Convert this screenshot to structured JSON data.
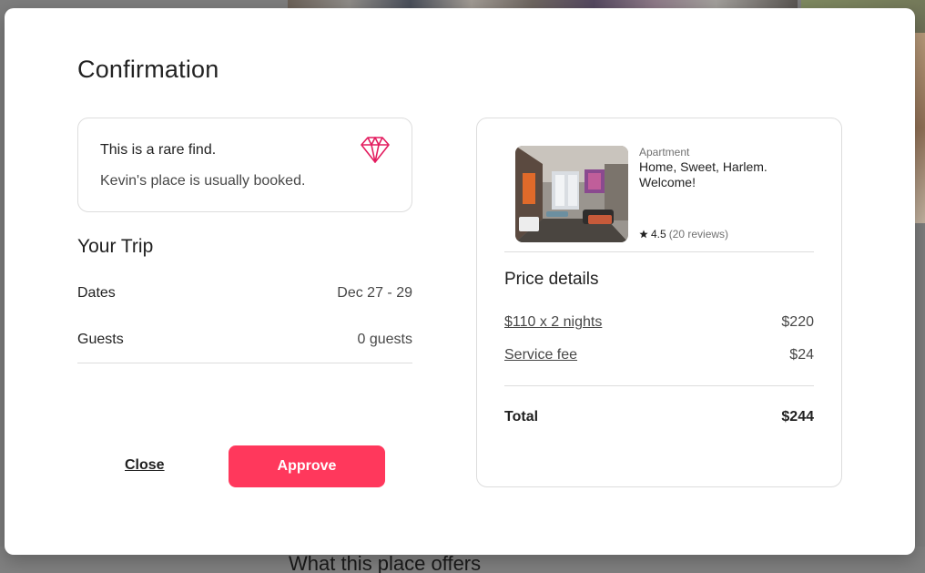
{
  "background": {
    "section_heading": "What this place offers"
  },
  "modal": {
    "title": "Confirmation",
    "rare_find": {
      "title": "This is a rare find.",
      "text": "Kevin's place is usually booked.",
      "icon": "diamond-icon",
      "icon_color": "#e31c5f"
    },
    "trip": {
      "title": "Your Trip",
      "rows": [
        {
          "label": "Dates",
          "value": "Dec 27 - 29"
        },
        {
          "label": "Guests",
          "value": "0 guests"
        }
      ]
    },
    "actions": {
      "close_label": "Close",
      "approve_label": "Approve",
      "approve_color": "#ff385c"
    },
    "listing": {
      "type": "Apartment",
      "name": "Home, Sweet, Harlem. Welcome!",
      "rating": "4.5",
      "reviews": "(20 reviews)",
      "icon": "star-icon"
    },
    "price": {
      "title": "Price details",
      "rows": [
        {
          "label": "$110 x 2 nights",
          "value": "$220"
        },
        {
          "label": "Service fee",
          "value": "$24"
        }
      ],
      "total_label": "Total",
      "total_value": "$244"
    }
  }
}
